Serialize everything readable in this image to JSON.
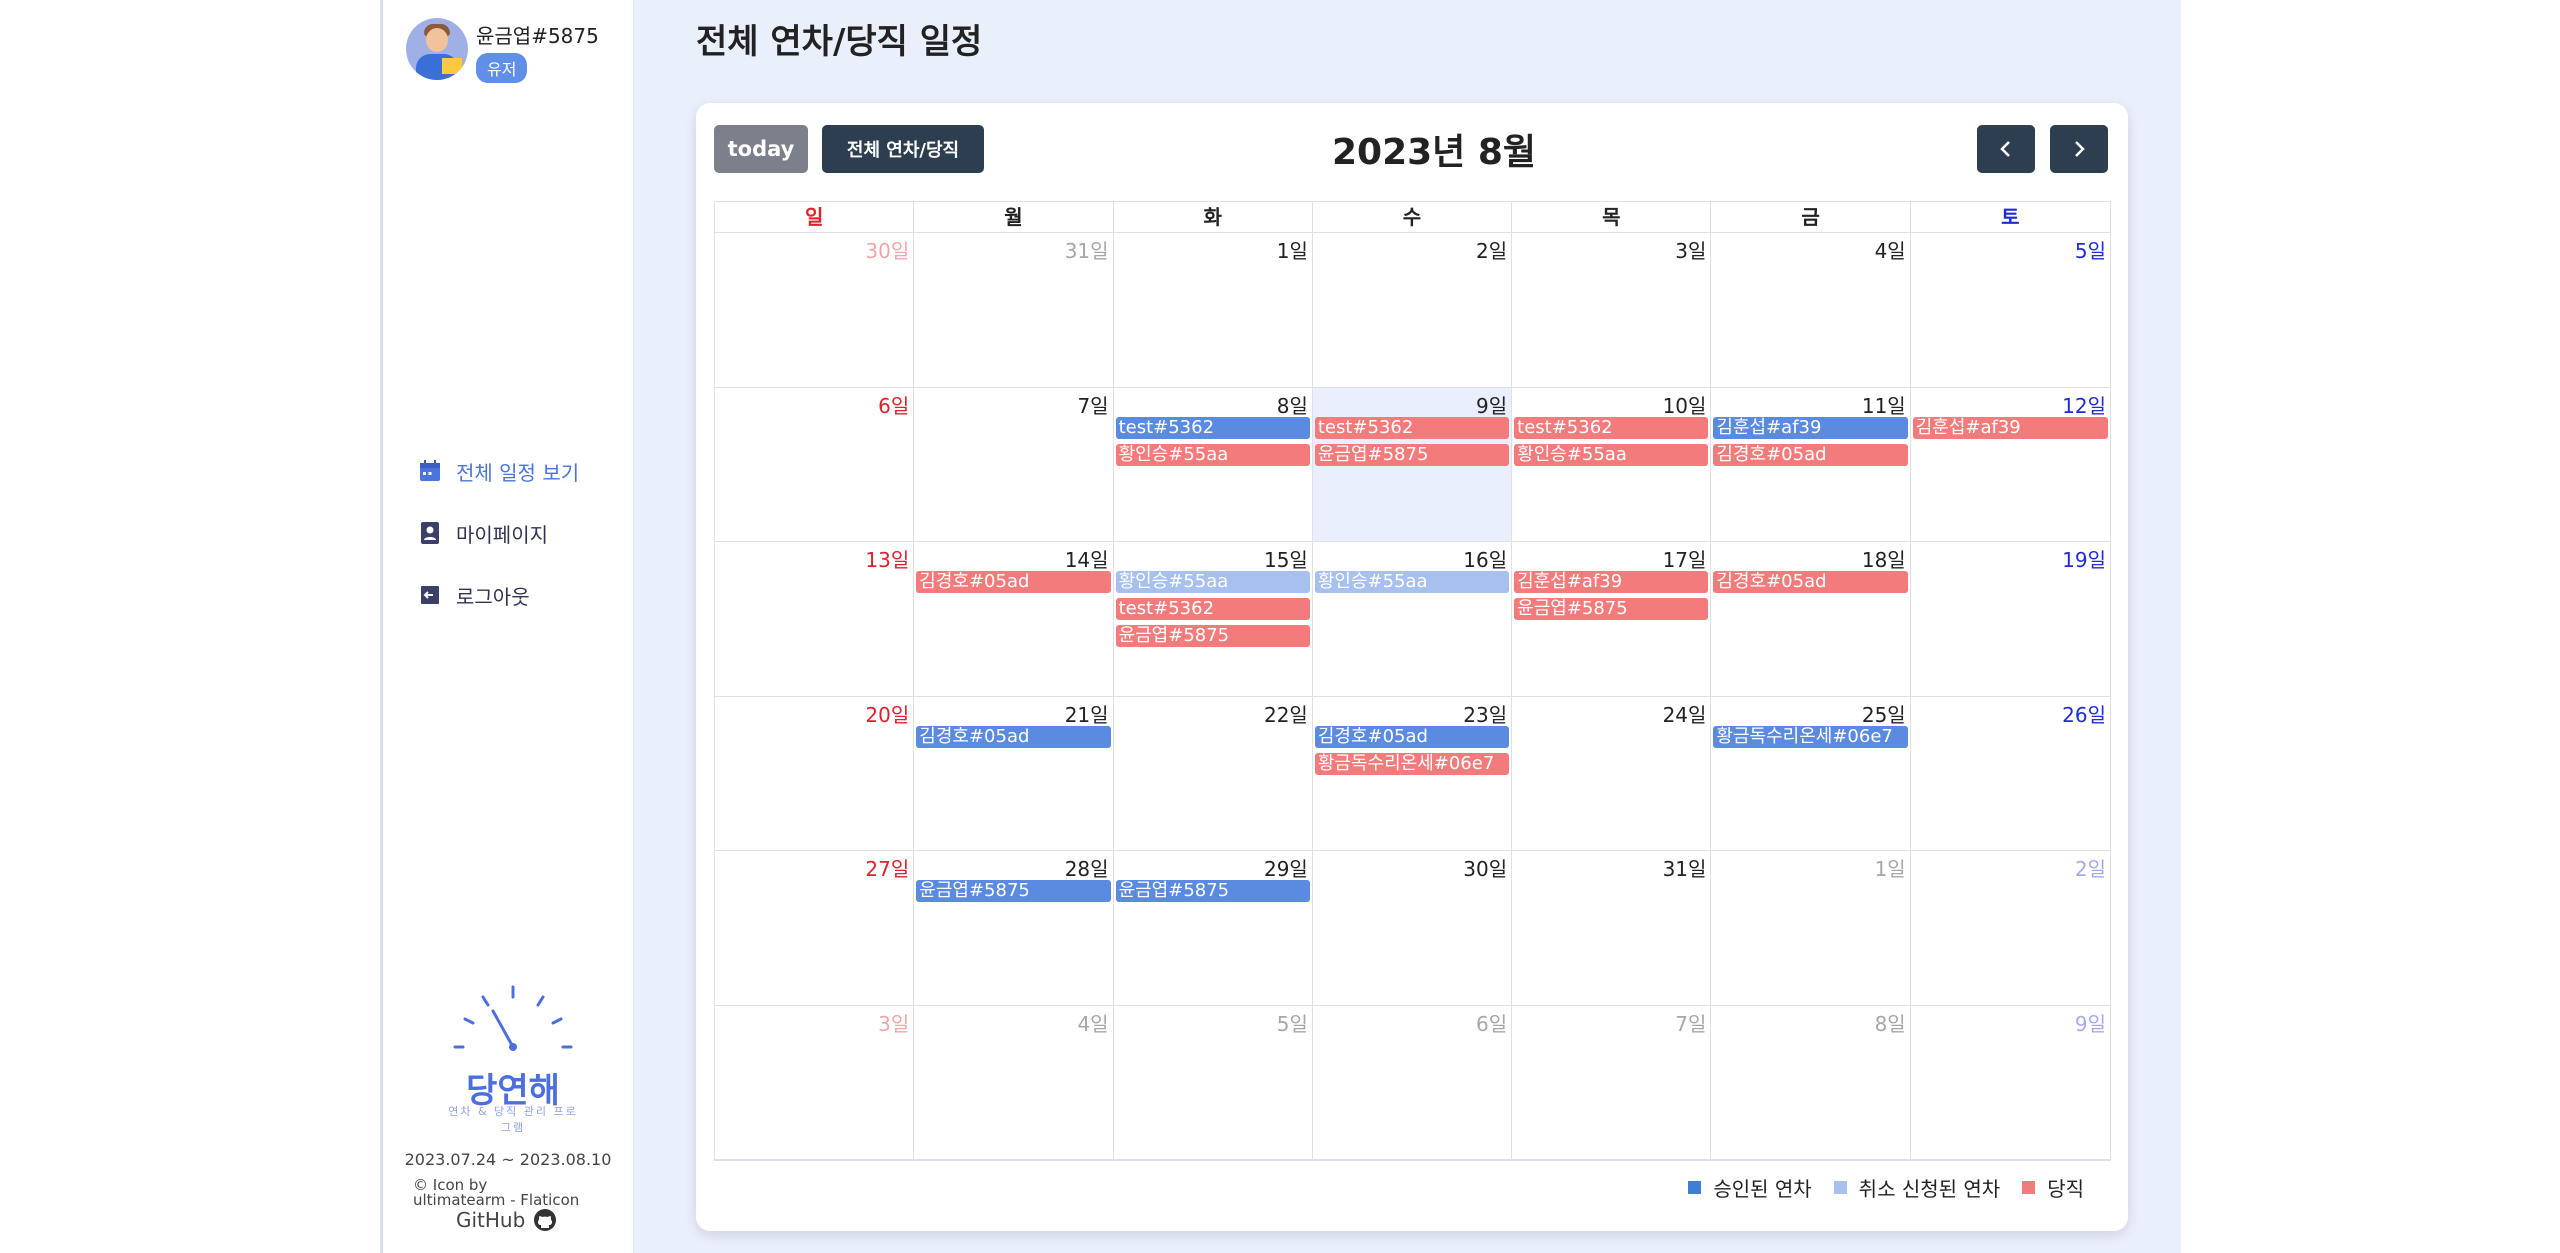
{
  "colors": {
    "accent": "#4a74d9",
    "approved": "#5b8be0",
    "cancel_requested": "#a7c0ee",
    "duty": "#f47b7b",
    "sunday": "#e0212b",
    "saturday": "#1f2bd8",
    "dark_button": "#2c3e50",
    "today_button": "#7b808a"
  },
  "user": {
    "name": "윤금엽#5875",
    "role_badge": "유저"
  },
  "nav": [
    {
      "label": "전체 일정 보기",
      "icon": "calendar-icon",
      "active": true
    },
    {
      "label": "마이페이지",
      "icon": "profile-icon",
      "active": false
    },
    {
      "label": "로그아웃",
      "icon": "logout-icon",
      "active": false
    }
  ],
  "logo": {
    "title": "당연해",
    "subtitle": "연차 & 당직 관리 프로그램"
  },
  "footer": {
    "period": "2023.07.24 ~ 2023.08.10",
    "credit_line1": "© Icon by",
    "credit_line2": "ultimatearm - Flaticon",
    "github_label": "GitHub",
    "github_icon": "github-icon"
  },
  "page": {
    "title": "전체 연차/당직 일정"
  },
  "toolbar": {
    "today_label": "today",
    "view_label": "전체 연차/당직",
    "month_title": "2023년 8월",
    "prev_icon": "chevron-left-icon",
    "next_icon": "chevron-right-icon"
  },
  "weekdays": [
    "일",
    "월",
    "화",
    "수",
    "목",
    "금",
    "토"
  ],
  "weeks": [
    [
      {
        "label": "30일",
        "muted": true,
        "events": []
      },
      {
        "label": "31일",
        "muted": true,
        "events": []
      },
      {
        "label": "1일",
        "events": []
      },
      {
        "label": "2일",
        "events": []
      },
      {
        "label": "3일",
        "events": []
      },
      {
        "label": "4일",
        "events": []
      },
      {
        "label": "5일",
        "events": []
      }
    ],
    [
      {
        "label": "6일",
        "events": []
      },
      {
        "label": "7일",
        "events": []
      },
      {
        "label": "8일",
        "events": [
          {
            "title": "test#5362",
            "type": "approved"
          },
          {
            "title": "황인승#55aa",
            "type": "duty"
          }
        ]
      },
      {
        "label": "9일",
        "today": true,
        "events": [
          {
            "title": "test#5362",
            "type": "duty"
          },
          {
            "title": "윤금엽#5875",
            "type": "duty"
          }
        ]
      },
      {
        "label": "10일",
        "events": [
          {
            "title": "test#5362",
            "type": "duty"
          },
          {
            "title": "황인승#55aa",
            "type": "duty"
          }
        ]
      },
      {
        "label": "11일",
        "events": [
          {
            "title": "김훈섭#af39",
            "type": "approved"
          },
          {
            "title": "김경호#05ad",
            "type": "duty"
          }
        ]
      },
      {
        "label": "12일",
        "events": [
          {
            "title": "김훈섭#af39",
            "type": "duty"
          }
        ]
      }
    ],
    [
      {
        "label": "13일",
        "events": []
      },
      {
        "label": "14일",
        "events": [
          {
            "title": "김경호#05ad",
            "type": "duty"
          }
        ]
      },
      {
        "label": "15일",
        "events": [
          {
            "title": "황인승#55aa",
            "type": "cancel"
          },
          {
            "title": "test#5362",
            "type": "duty"
          },
          {
            "title": "윤금엽#5875",
            "type": "duty"
          }
        ]
      },
      {
        "label": "16일",
        "events": [
          {
            "title": "황인승#55aa",
            "type": "cancel"
          }
        ]
      },
      {
        "label": "17일",
        "events": [
          {
            "title": "김훈섭#af39",
            "type": "duty"
          },
          {
            "title": "윤금엽#5875",
            "type": "duty"
          }
        ]
      },
      {
        "label": "18일",
        "events": [
          {
            "title": "김경호#05ad",
            "type": "duty"
          }
        ]
      },
      {
        "label": "19일",
        "events": []
      }
    ],
    [
      {
        "label": "20일",
        "events": []
      },
      {
        "label": "21일",
        "events": [
          {
            "title": "김경호#05ad",
            "type": "approved"
          }
        ]
      },
      {
        "label": "22일",
        "events": []
      },
      {
        "label": "23일",
        "events": [
          {
            "title": "김경호#05ad",
            "type": "approved"
          },
          {
            "title": "황금독수리온세#06e7",
            "type": "duty"
          }
        ]
      },
      {
        "label": "24일",
        "events": []
      },
      {
        "label": "25일",
        "events": [
          {
            "title": "황금독수리온세#06e7",
            "type": "approved"
          }
        ]
      },
      {
        "label": "26일",
        "events": []
      }
    ],
    [
      {
        "label": "27일",
        "events": []
      },
      {
        "label": "28일",
        "events": [
          {
            "title": "윤금엽#5875",
            "type": "approved"
          }
        ]
      },
      {
        "label": "29일",
        "events": [
          {
            "title": "윤금엽#5875",
            "type": "approved"
          }
        ]
      },
      {
        "label": "30일",
        "events": []
      },
      {
        "label": "31일",
        "events": []
      },
      {
        "label": "1일",
        "muted": true,
        "events": []
      },
      {
        "label": "2일",
        "muted": true,
        "events": []
      }
    ],
    [
      {
        "label": "3일",
        "muted": true,
        "events": []
      },
      {
        "label": "4일",
        "muted": true,
        "events": []
      },
      {
        "label": "5일",
        "muted": true,
        "events": []
      },
      {
        "label": "6일",
        "muted": true,
        "events": []
      },
      {
        "label": "7일",
        "muted": true,
        "events": []
      },
      {
        "label": "8일",
        "muted": true,
        "events": []
      },
      {
        "label": "9일",
        "muted": true,
        "events": []
      }
    ]
  ],
  "legend": [
    {
      "label": "승인된 연차",
      "type": "approved"
    },
    {
      "label": "취소 신청된 연차",
      "type": "cancel"
    },
    {
      "label": "당직",
      "type": "duty"
    }
  ]
}
